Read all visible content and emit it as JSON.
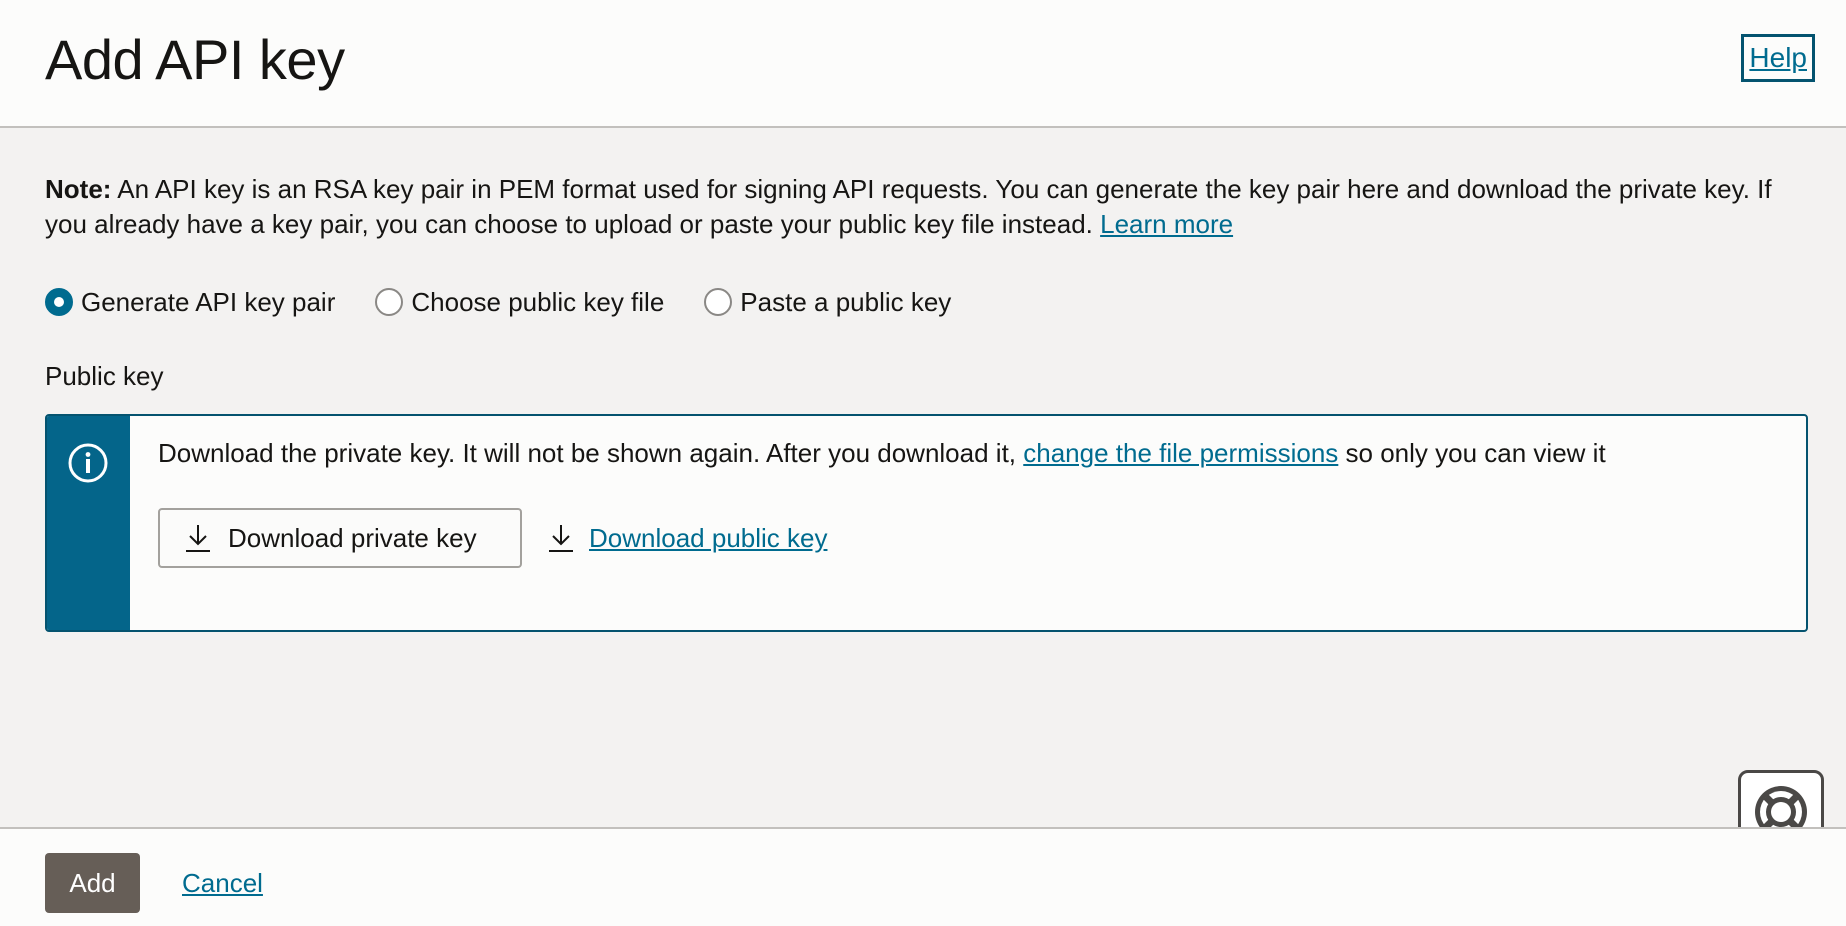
{
  "header": {
    "title": "Add API key",
    "help_label": "Help"
  },
  "note": {
    "prefix": "Note:",
    "text": " An API key is an RSA key pair in PEM format used for signing API requests. You can generate the key pair here and download the private key. If you already have a key pair, you can choose to upload or paste your public key file instead. ",
    "learn_more": "Learn more"
  },
  "key_options": [
    {
      "label": "Generate API key pair",
      "checked": true
    },
    {
      "label": "Choose public key file",
      "checked": false
    },
    {
      "label": "Paste a public key",
      "checked": false
    }
  ],
  "public_key": {
    "label": "Public key",
    "info_text_before": "Download the private key. It will not be shown again. After you download it, ",
    "info_link": "change the file permissions",
    "info_text_after": " so only you can view it",
    "download_private_label": "Download private key",
    "download_public_label": "Download public key"
  },
  "footer": {
    "add_label": "Add",
    "cancel_label": "Cancel"
  },
  "colors": {
    "accent": "#006b8f",
    "info_stripe": "#04658a",
    "primary_button": "#665e57",
    "background": "#f3f2f1"
  },
  "icons": {
    "info": "info-icon",
    "download": "download-icon",
    "help_widget": "lifebuoy-icon",
    "grid": "grid-icon"
  }
}
